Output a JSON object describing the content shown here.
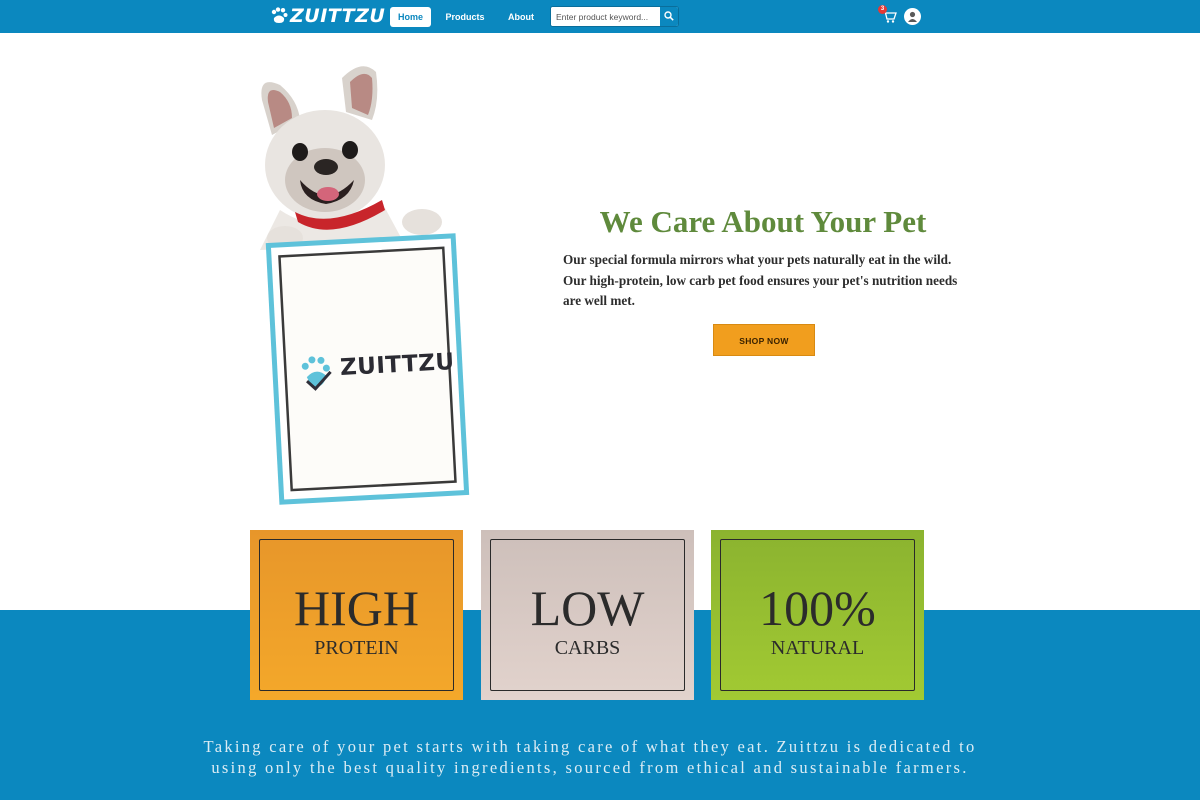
{
  "navbar": {
    "logo_text": "ZUITTZU",
    "links": [
      {
        "label": "Home",
        "active": true
      },
      {
        "label": "Products",
        "active": false
      },
      {
        "label": "About",
        "active": false
      }
    ],
    "search": {
      "placeholder": "Enter product keyword..."
    },
    "cart": {
      "count": "3",
      "icon": "cart-icon"
    },
    "avatar_icon": "user-avatar"
  },
  "hero": {
    "title": "We Care About Your Pet",
    "description": "Our special formula mirrors what your pets naturally eat in the wild. Our high-protein, low carb pet food ensures your pet's nutrition needs are well met.",
    "button_label": "SHOP NOW",
    "sign_text": "ZUITTZU"
  },
  "features": [
    {
      "big": "HIGH",
      "small": "PROTEIN",
      "color": "#f0a028"
    },
    {
      "big": "LOW",
      "small": "CARBS",
      "color": "#d9cac4"
    },
    {
      "big": "100%",
      "small": "NATURAL",
      "color": "#98c030"
    }
  ],
  "footer": {
    "text": "Taking care of your pet starts with taking care of what they eat. Zuittzu is dedicated to using only the best quality ingredients, sourced from ethical and sustainable farmers."
  },
  "colors": {
    "primary": "#0b88bf",
    "title_green": "#5f8a3c",
    "button_orange": "#f19e1e"
  }
}
